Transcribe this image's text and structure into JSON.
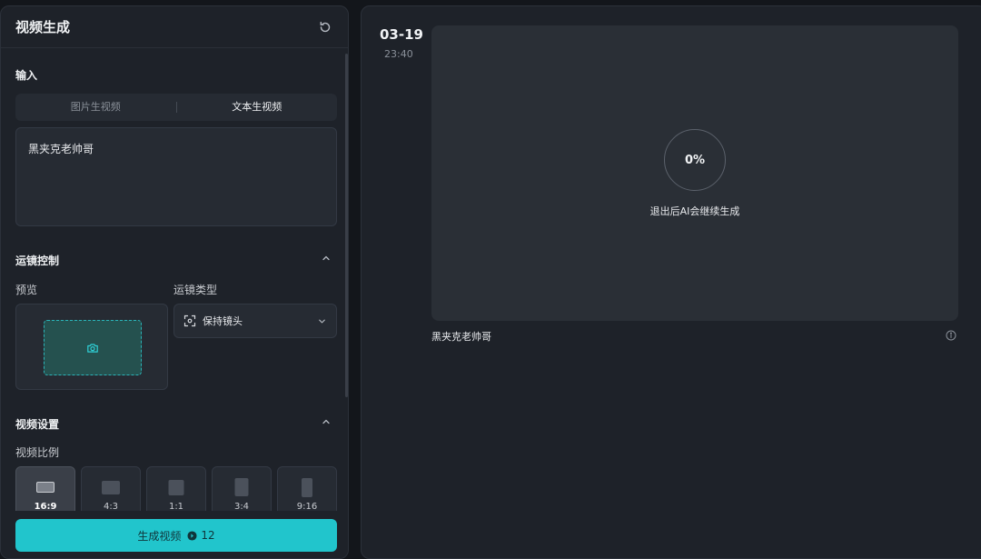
{
  "left_panel": {
    "title": "视频生成",
    "input_section": {
      "label": "输入",
      "tabs": [
        {
          "label": "图片生视频",
          "active": false
        },
        {
          "label": "文本生视频",
          "active": true
        }
      ],
      "prompt_value": "黑夹克老帅哥"
    },
    "camera_section": {
      "label": "运镜控制",
      "preview_label": "预览",
      "type_label": "运镜类型",
      "type_value": "保持镜头",
      "preview_icon": "camera-icon"
    },
    "video_settings": {
      "label": "视频设置",
      "ratio_label": "视频比例",
      "ratios": [
        {
          "label": "16:9",
          "active": true
        },
        {
          "label": "4:3",
          "active": false
        },
        {
          "label": "1:1",
          "active": false
        },
        {
          "label": "3:4",
          "active": false
        },
        {
          "label": "9:16",
          "active": false
        }
      ]
    },
    "generate_button": {
      "label": "生成视频",
      "credits": "12"
    }
  },
  "right_panel": {
    "date": "03-19",
    "time": "23:40",
    "progress": "0%",
    "progress_note": "退出后AI会继续生成",
    "caption": "黑夹克老帅哥"
  },
  "colors": {
    "accent": "#21c5cc",
    "panel": "#1e2229",
    "background": "#13161b"
  }
}
